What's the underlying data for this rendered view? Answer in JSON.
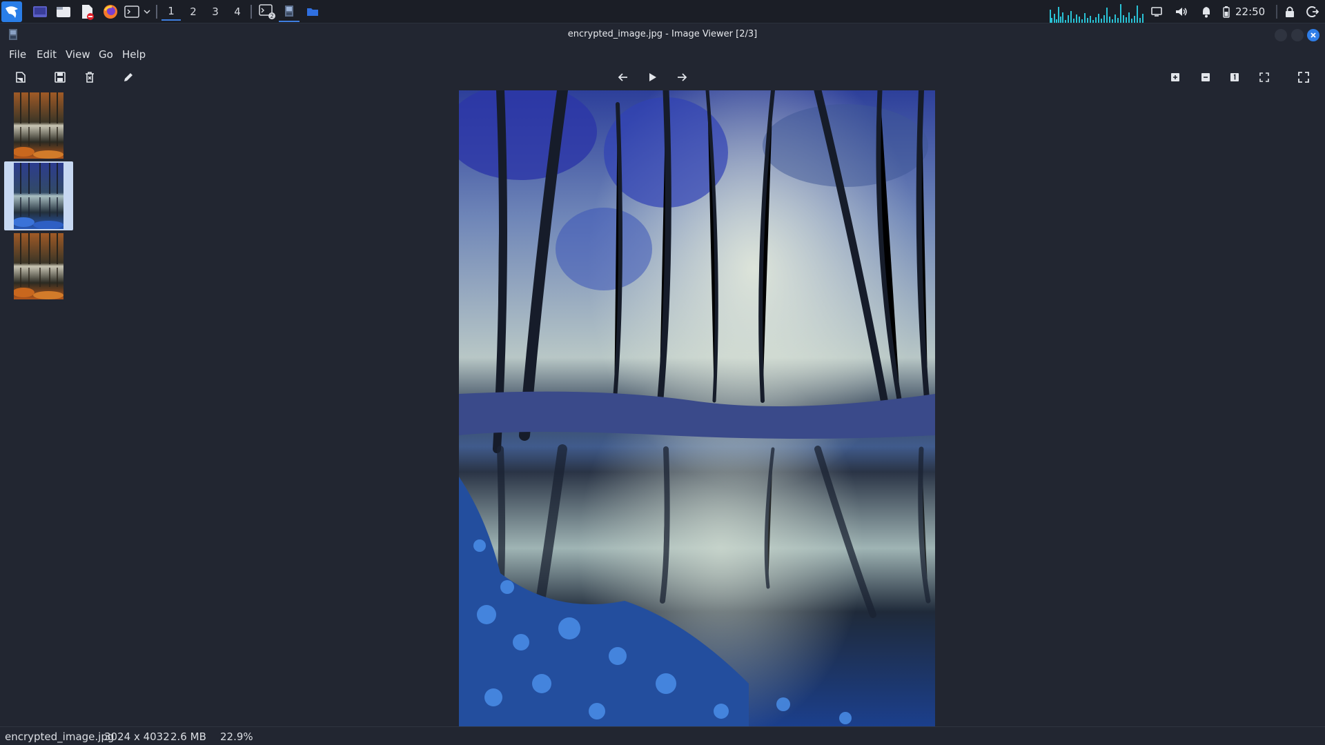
{
  "taskbar": {
    "workspaces": [
      "1",
      "2",
      "3",
      "4"
    ],
    "active_workspace": "1",
    "clock": "22:50",
    "icons": [
      "kali-menu-icon",
      "desktop-icon",
      "file-manager-icon",
      "text-editor-icon",
      "firefox-icon",
      "terminal-icon",
      "dropdown-icon",
      "terminal-window-icon",
      "image-viewer-window-icon",
      "folder-window-icon",
      "cpu-graph",
      "display-icon",
      "volume-icon",
      "notification-icon",
      "battery-icon",
      "lock-icon",
      "logout-icon"
    ]
  },
  "window": {
    "title": "encrypted_image.jpg - Image Viewer [2/3]"
  },
  "menu": {
    "file": "File",
    "edit": "Edit",
    "view": "View",
    "go": "Go",
    "help": "Help"
  },
  "thumbnails": {
    "count": 3,
    "selected_index": 1,
    "items": [
      "autumn-forest",
      "blue-forest",
      "autumn-forest"
    ]
  },
  "status": {
    "filename": "encrypted_image.jpg",
    "dimensions": "3024 x 4032",
    "size": "2.6 MB",
    "zoom": "22.9%"
  },
  "colors": {
    "background": "#222631",
    "panel": "#1b1e26",
    "accent": "#3f7fe0",
    "selection": "#c7d8f2"
  }
}
